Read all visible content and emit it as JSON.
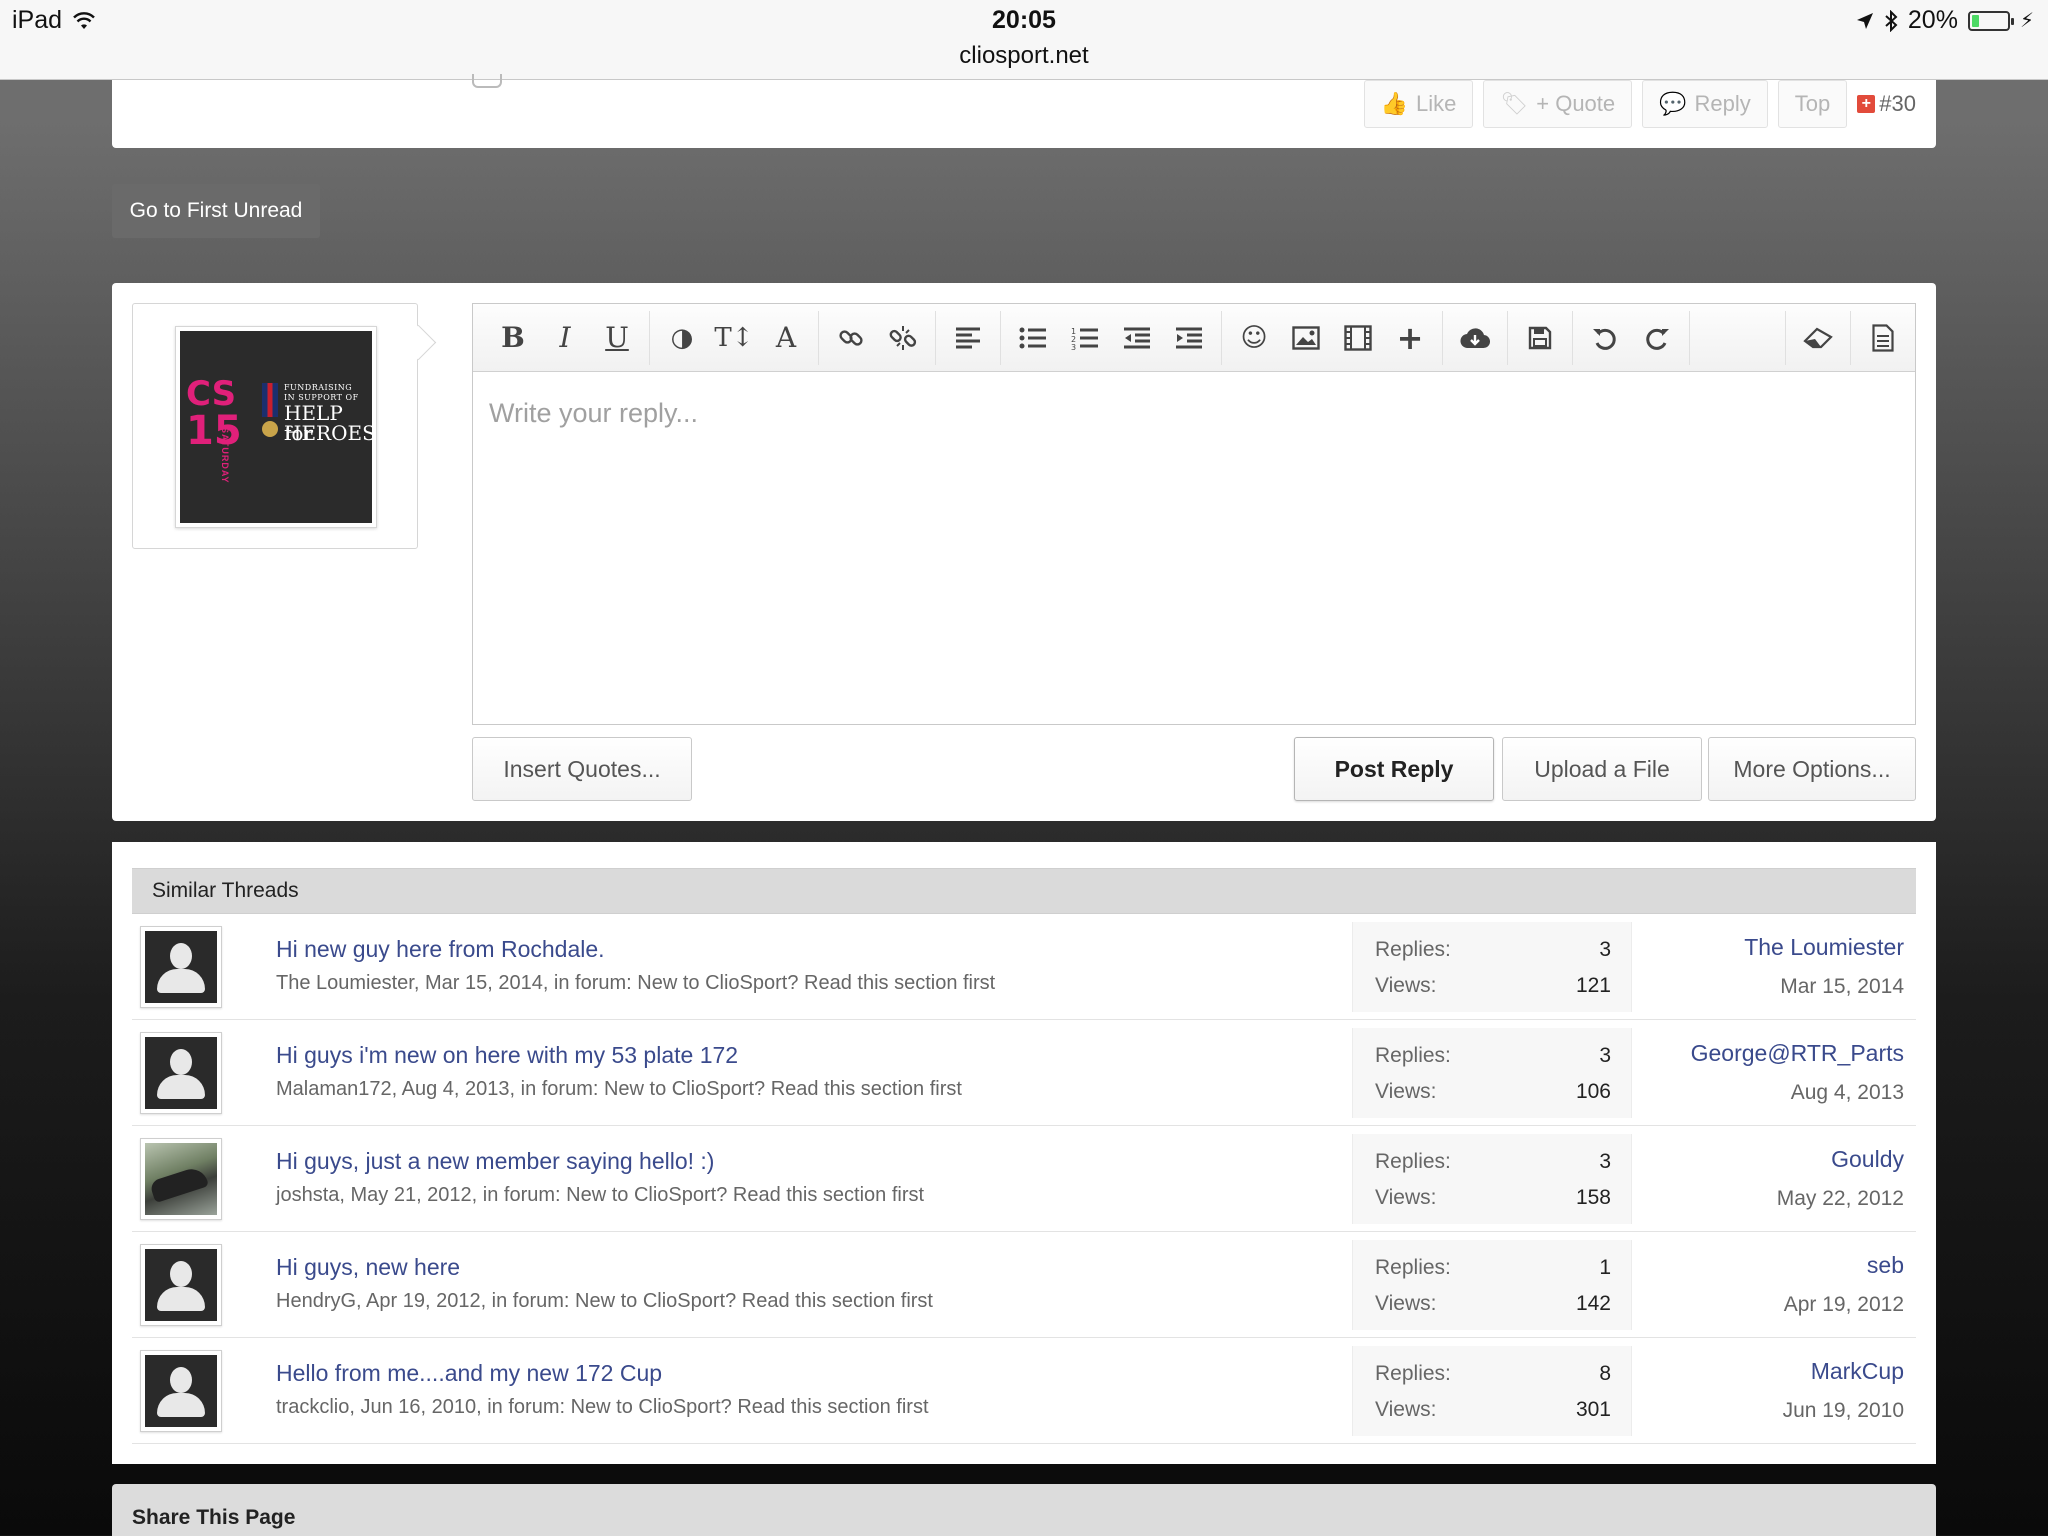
{
  "status_bar": {
    "device": "iPad",
    "time": "20:05",
    "url": "cliosport.net",
    "battery": "20%",
    "battery_level": 0.2
  },
  "post_actions": {
    "like": "Like",
    "quote": "+ Quote",
    "reply": "Reply",
    "top": "Top",
    "post_number": "#30"
  },
  "go_first_unread": "Go to First Unread",
  "avatar": {
    "cs": "CS",
    "number": "15",
    "saturday": "SATURDAY",
    "fundraising": "FUNDRAISING\nIN SUPPORT OF",
    "help_for": "HELP for",
    "heroes": "HEROES"
  },
  "editor": {
    "placeholder": "Write your reply...",
    "toolbar_icons": [
      "bold-icon",
      "italic-icon",
      "underline-icon",
      "color-icon",
      "font-size-icon",
      "font-family-icon",
      "link-icon",
      "unlink-icon",
      "align-left-icon",
      "bulleted-list-icon",
      "numbered-list-icon",
      "outdent-icon",
      "indent-icon",
      "smilies-icon",
      "image-icon",
      "media-icon",
      "insert-more-icon",
      "drafts-icon",
      "save-icon",
      "undo-icon",
      "redo-icon",
      "remove-formatting-icon",
      "bbcode-toggle-icon"
    ]
  },
  "reply_actions": {
    "insert_quotes": "Insert Quotes...",
    "post_reply": "Post Reply",
    "upload_file": "Upload a File",
    "more_options": "More Options..."
  },
  "similar_threads": {
    "heading": "Similar Threads",
    "replies_label": "Replies:",
    "views_label": "Views:",
    "rows": [
      {
        "title": "Hi new guy here from Rochdale.",
        "meta": "The Loumiester, Mar 15, 2014, in forum: New to ClioSport? Read this section first",
        "replies": "3",
        "views": "121",
        "last_user": "The Loumiester",
        "last_date": "Mar 15, 2014",
        "avatar": "default"
      },
      {
        "title": "Hi guys i'm new on here with my 53 plate 172",
        "meta": "Malaman172, Aug 4, 2013, in forum: New to ClioSport? Read this section first",
        "replies": "3",
        "views": "106",
        "last_user": "George@RTR_Parts",
        "last_date": "Aug 4, 2013",
        "avatar": "default"
      },
      {
        "title": "Hi guys, just a new member saying hello! :)",
        "meta": "joshsta, May 21, 2012, in forum: New to ClioSport? Read this section first",
        "replies": "3",
        "views": "158",
        "last_user": "Gouldy",
        "last_date": "May 22, 2012",
        "avatar": "photo"
      },
      {
        "title": "Hi guys, new here",
        "meta": "HendryG, Apr 19, 2012, in forum: New to ClioSport? Read this section first",
        "replies": "1",
        "views": "142",
        "last_user": "seb",
        "last_date": "Apr 19, 2012",
        "avatar": "default"
      },
      {
        "title": "Hello from me....and my new 172 Cup",
        "meta": "trackclio, Jun 16, 2010, in forum: New to ClioSport? Read this section first",
        "replies": "8",
        "views": "301",
        "last_user": "MarkCup",
        "last_date": "Jun 19, 2010",
        "avatar": "default"
      }
    ]
  },
  "share": {
    "title": "Share This Page"
  }
}
